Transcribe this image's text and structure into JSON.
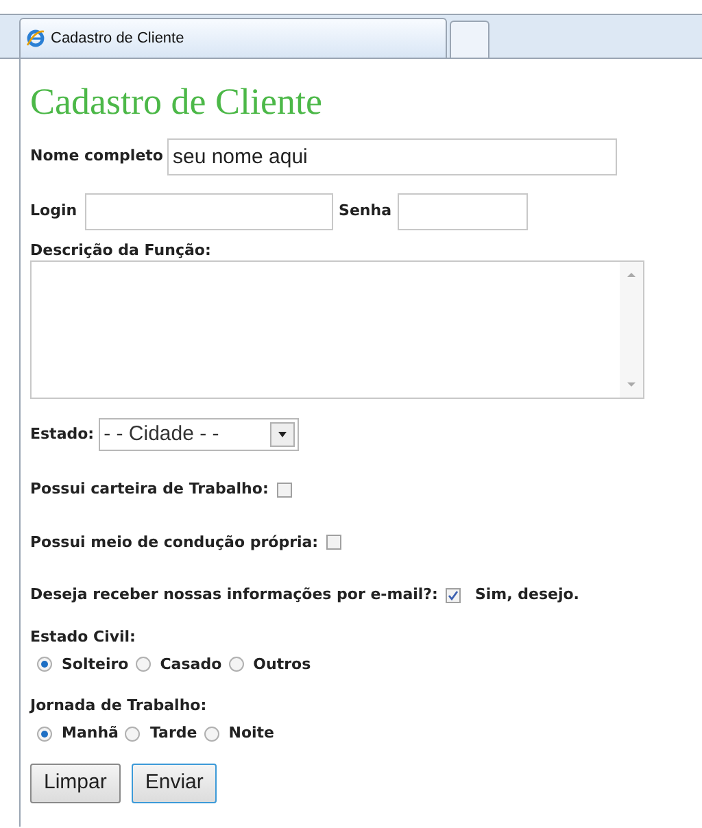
{
  "tab": {
    "title": "Cadastro de Cliente"
  },
  "heading": "Cadastro de Cliente",
  "name_field": {
    "label": "Nome completo",
    "value": "seu nome aqui"
  },
  "login_field": {
    "label": "Login"
  },
  "password_field": {
    "label": "Senha"
  },
  "description": {
    "label": "Descrição da Função:"
  },
  "state_select": {
    "label": "Estado:",
    "value": "- - Cidade - -"
  },
  "checks": [
    {
      "label": "Possui carteira de Trabalho:",
      "checked": false
    },
    {
      "label": "Possui meio de condução própria:",
      "checked": false
    },
    {
      "label": "Deseja receber nossas informações por e-mail?:",
      "checked": true,
      "caption": "Sim, desejo."
    }
  ],
  "radio_groups": [
    {
      "label": "Estado Civil:",
      "options": [
        {
          "label": "Solteiro",
          "selected": true
        },
        {
          "label": "Casado",
          "selected": false
        },
        {
          "label": "Outros",
          "selected": false
        }
      ]
    },
    {
      "label": "Jornada de Trabalho:",
      "options": [
        {
          "label": "Manhã",
          "selected": true
        },
        {
          "label": "Tarde",
          "selected": false
        },
        {
          "label": "Noite",
          "selected": false
        }
      ]
    }
  ],
  "buttons": [
    {
      "label": "Limpar",
      "focused": false
    },
    {
      "label": "Enviar",
      "focused": true
    }
  ]
}
